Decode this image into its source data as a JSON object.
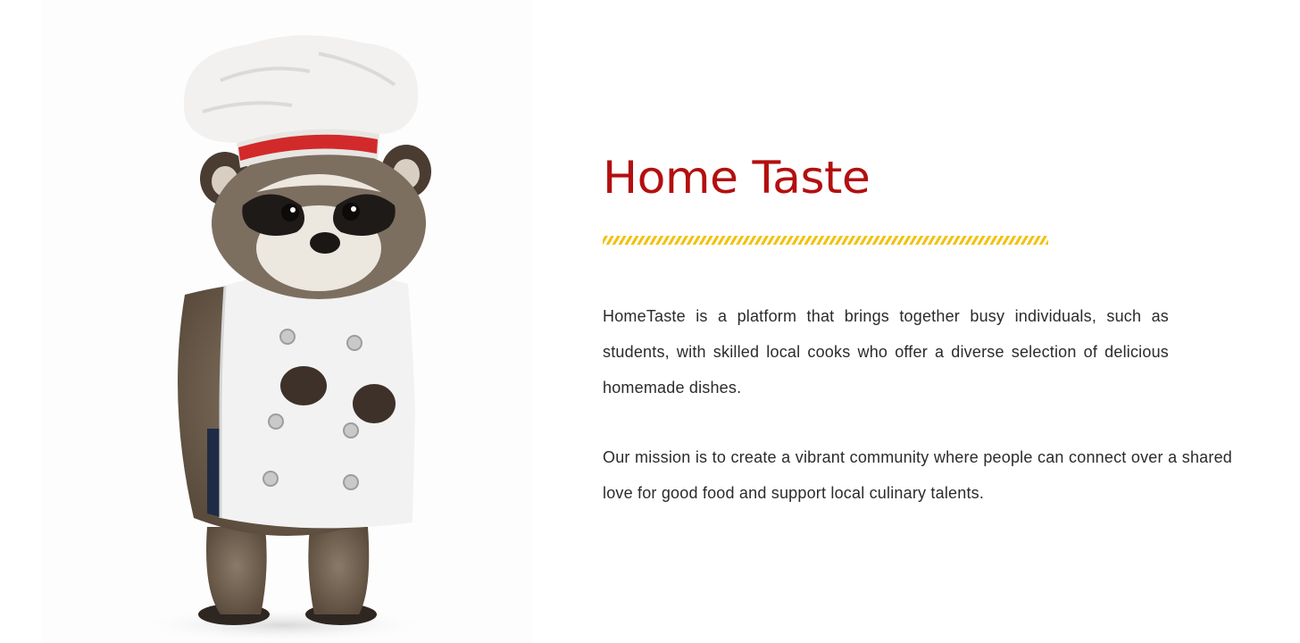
{
  "about": {
    "title": "Home Taste",
    "paragraphs": [
      "HomeTaste is a platform that brings together busy individuals, such as students, with skilled local cooks who offer a diverse selection of delicious homemade dishes.",
      "Our mission is to create a vibrant community where people can connect over a shared love for good food and support local culinary talents."
    ],
    "image": {
      "subject": "raccoon-chef-illustration"
    }
  },
  "colors": {
    "title": "#b30f0f",
    "divider": "#f3c10c",
    "body_text": "#2b2b2b",
    "background": "#ffffff"
  }
}
